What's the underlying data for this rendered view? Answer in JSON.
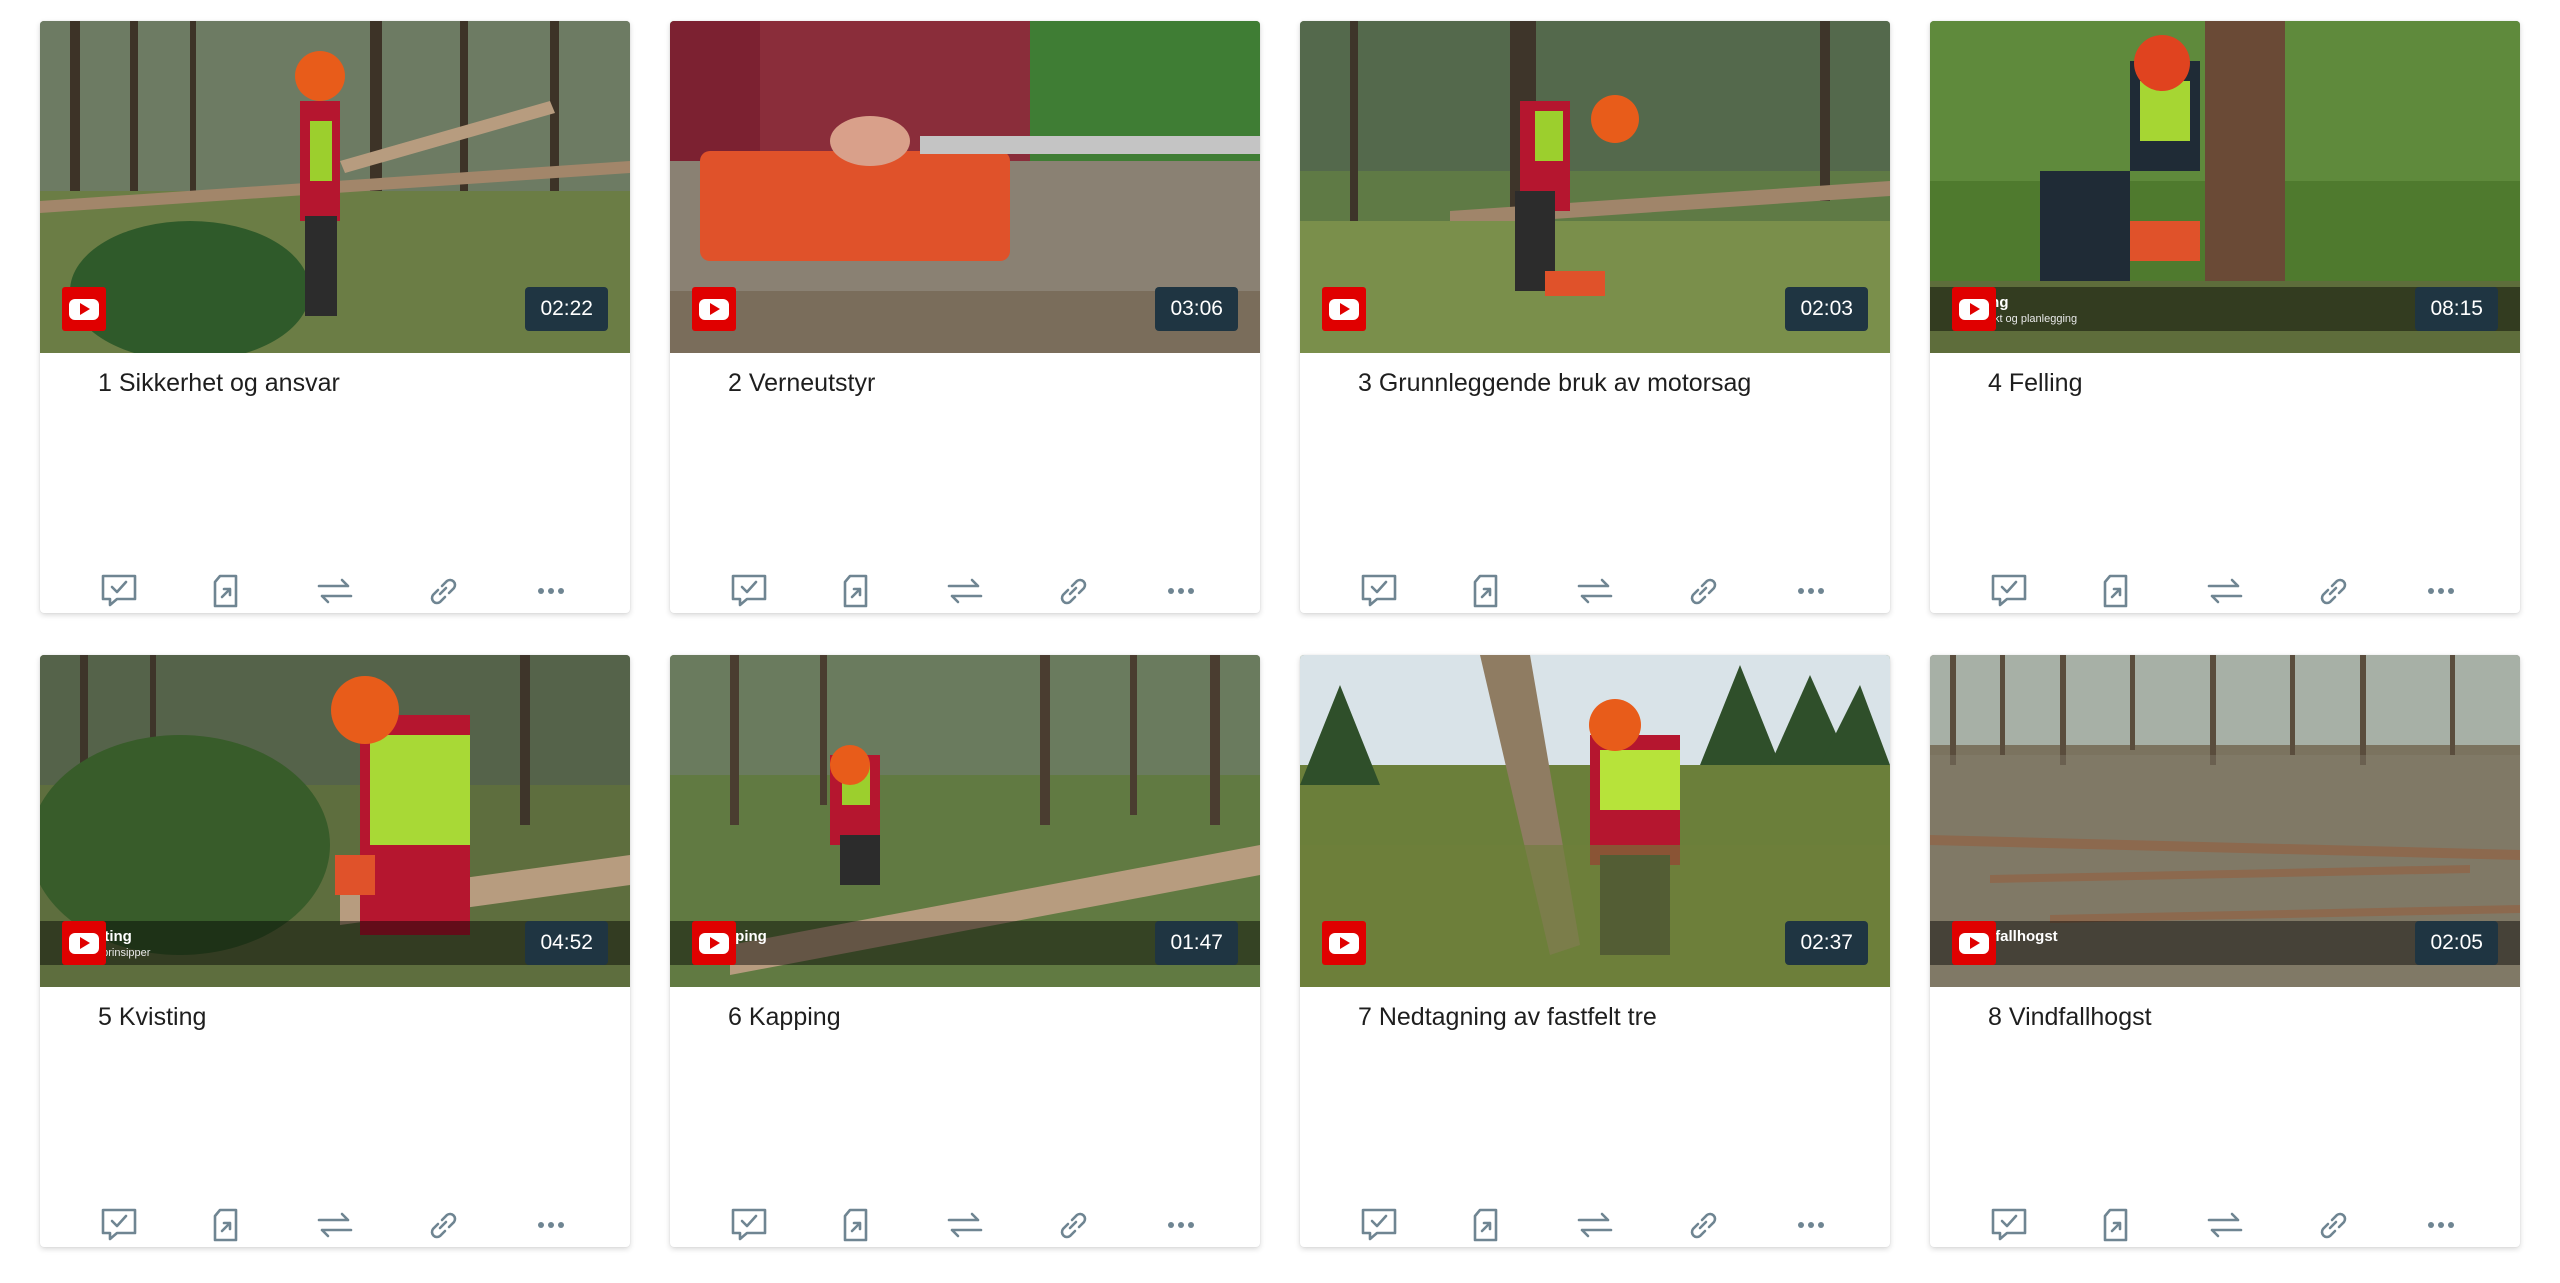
{
  "colors": {
    "youtube_red": "#e00000",
    "duration_bg": "#1f3542",
    "icon_gray": "#6f8592"
  },
  "cards": [
    {
      "title": "1 Sikkerhet og ansvar",
      "duration": "02:22",
      "overlay_title": "",
      "overlay_sub": "",
      "scene": "forest-worker-cutting-log"
    },
    {
      "title": "2 Verneutstyr",
      "duration": "03:06",
      "overlay_title": "",
      "overlay_sub": "",
      "scene": "chainsaw-closeup"
    },
    {
      "title": "3 Grunnleggende bruk av motorsag",
      "duration": "02:03",
      "overlay_title": "",
      "overlay_sub": "",
      "scene": "worker-starting-saw"
    },
    {
      "title": "4 Felling",
      "duration": "08:15",
      "overlay_title": "ing",
      "overlay_sub": "sikt og planlegging",
      "scene": "worker-felling-tree"
    },
    {
      "title": "5 Kvisting",
      "duration": "04:52",
      "overlay_title": "sting",
      "overlay_sub": "nprinsipper",
      "scene": "worker-limbing"
    },
    {
      "title": "6 Kapping",
      "duration": "01:47",
      "overlay_title": "pping",
      "overlay_sub": "",
      "scene": "worker-bucking-log"
    },
    {
      "title": "7 Nedtagning av fastfelt tre",
      "duration": "02:37",
      "overlay_title": "",
      "overlay_sub": "",
      "scene": "worker-hung-tree"
    },
    {
      "title": "8 Vindfallhogst",
      "duration": "02:05",
      "overlay_title": "dfallhogst",
      "overlay_sub": "",
      "scene": "windfall-area"
    }
  ],
  "action_icons": [
    "comment-check-icon",
    "assign-icon",
    "swap-icon",
    "link-icon",
    "more-icon"
  ]
}
